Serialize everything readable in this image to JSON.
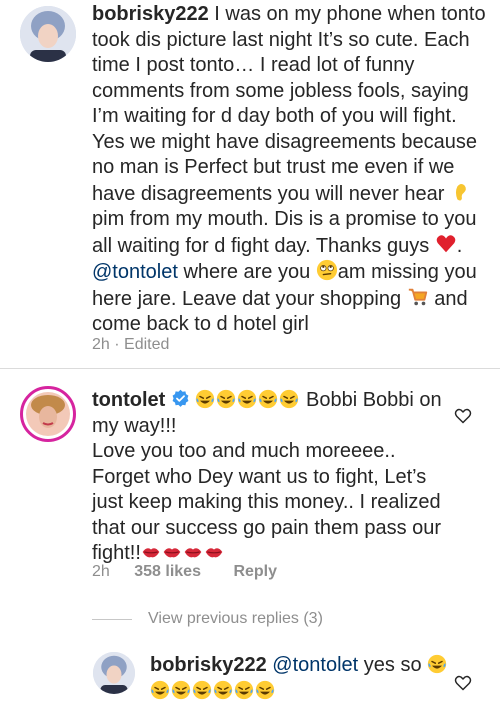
{
  "comment1": {
    "username": "bobrisky222",
    "text_a": " I was on my phone when tonto took dis picture last night It’s so cute. Each time I post tonto… I read lot of funny comments from some jobless fools, saying I’m waiting for d day both of you will fight. Yes we might have disagreements because no man is Perfect but trust me even if we have disagreements you will never hear ",
    "text_b": " pim from my mouth. Dis is a promise to you all waiting for d fight day. Thanks guys ",
    "text_c": ".",
    "mention": "@tontolet",
    "text_d": " where are you ",
    "text_e": "am missing you here jare. Leave dat your shopping ",
    "text_f": " and come back to d hotel girl",
    "time": "2h",
    "edited": "· Edited"
  },
  "comment2": {
    "username": "tontolet",
    "text_a": " Bobbi Bobbi on my way!!!\nLove you too and much moreeee..\nForget who Dey want us to fight, Let’s just keep making this money.. I realized that our success go pain them pass our fight!!",
    "time": "2h",
    "likes": "358 likes",
    "reply": "Reply"
  },
  "view_replies": "View previous replies (3)",
  "comment3": {
    "username": "bobrisky222",
    "mention": "@tontolet",
    "text_a": " yes so "
  },
  "colors": {
    "verified": "#3897f0",
    "mention": "#003569",
    "meta": "#8e8e8e",
    "story_ring": "#d6249f"
  },
  "icons": [
    "ear-emoji",
    "red-heart-emoji",
    "rolling-eyes-emoji",
    "shopping-cart-emoji",
    "laughing-tears-emoji",
    "kiss-lips-emoji",
    "verified-badge-icon",
    "heart-outline-icon"
  ]
}
